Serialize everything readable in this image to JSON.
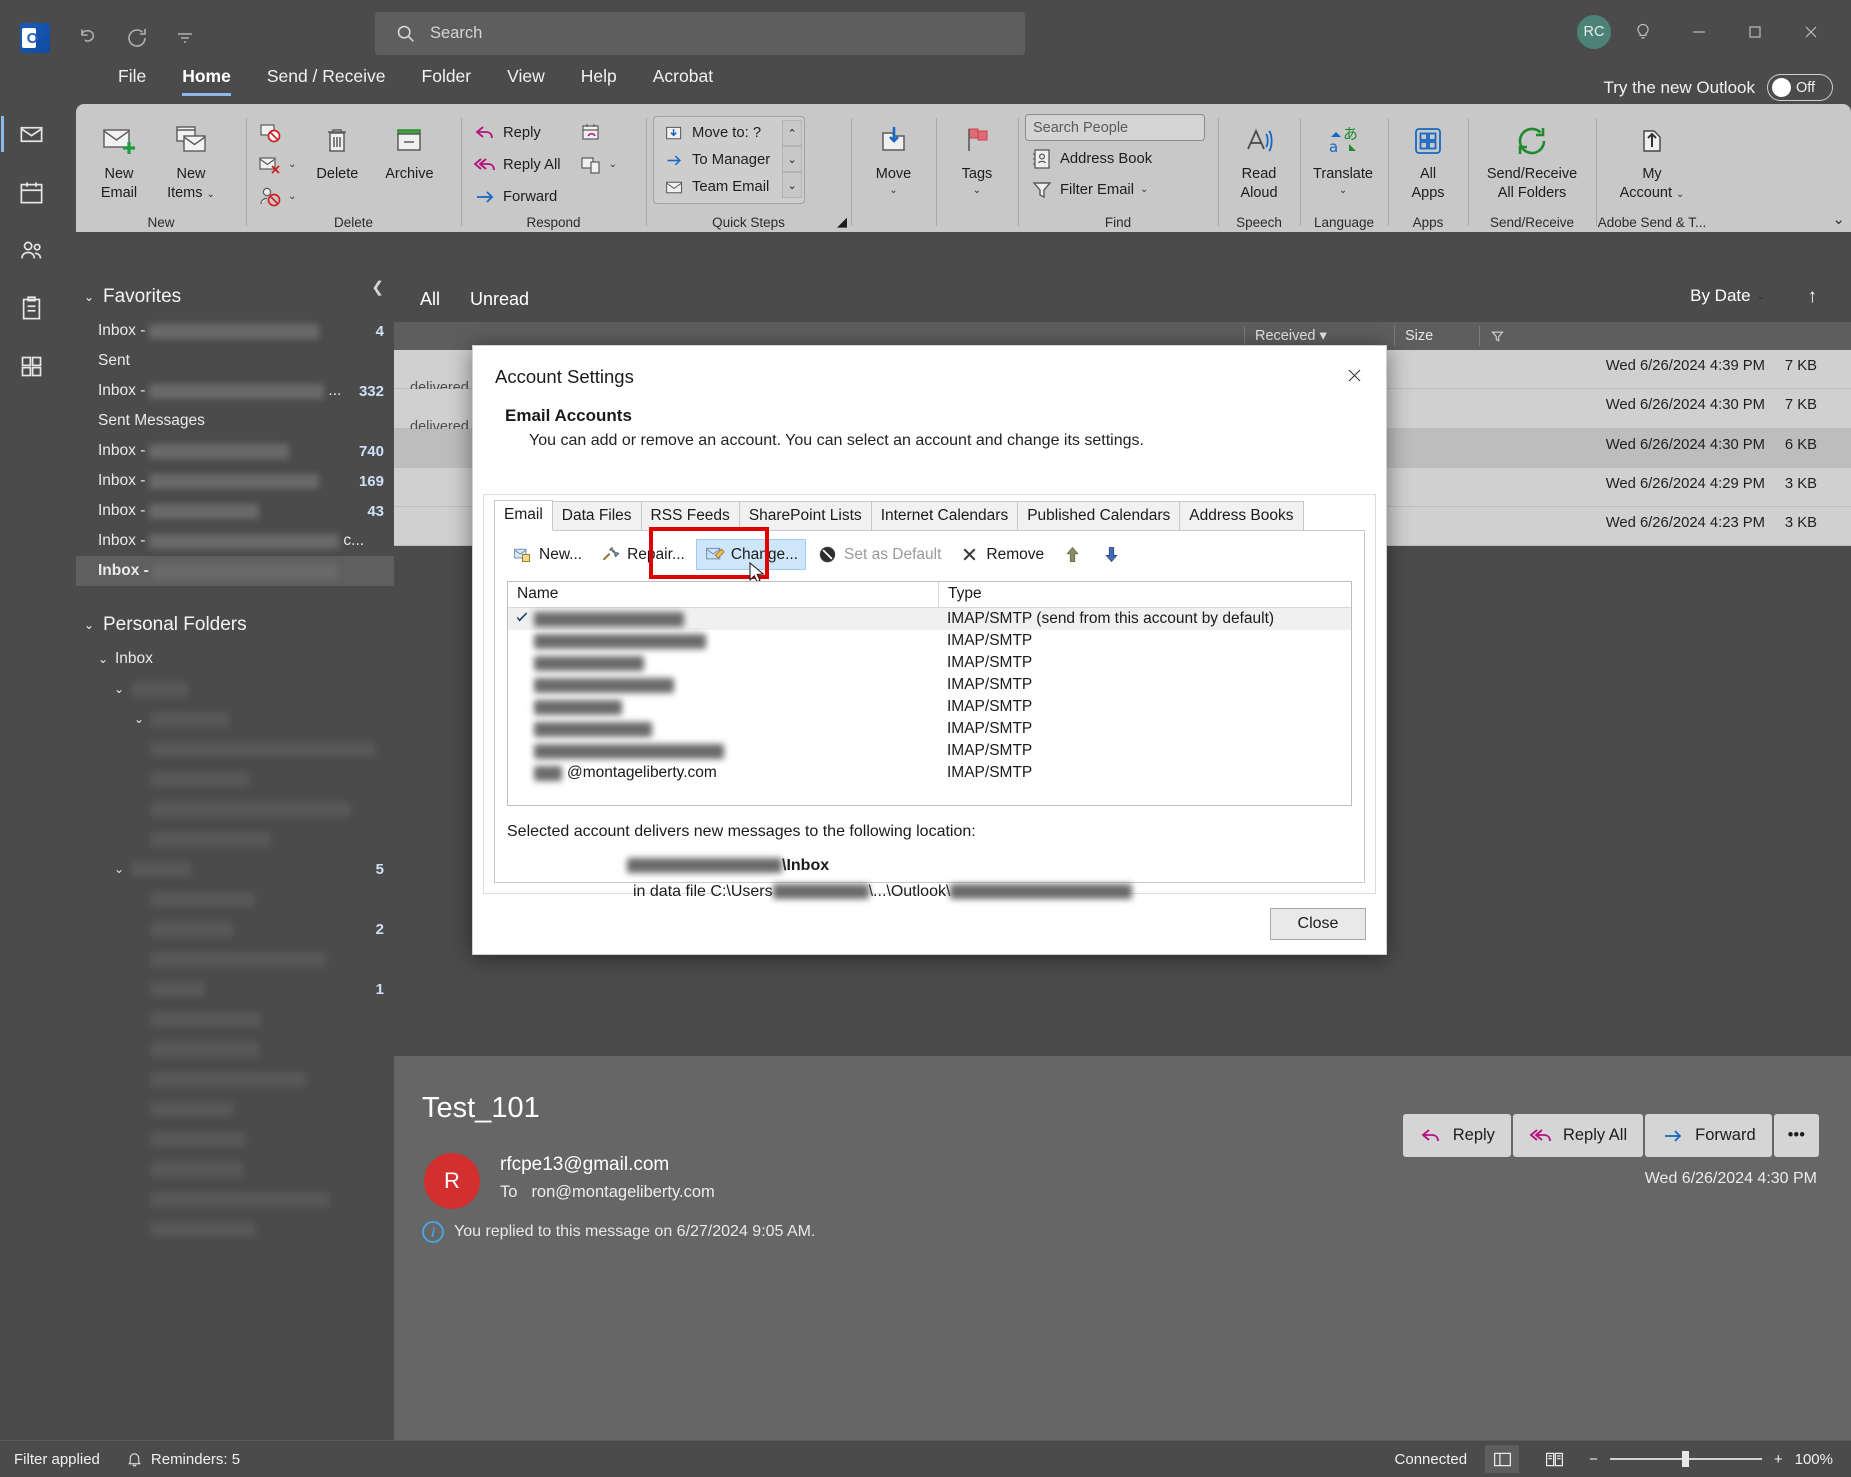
{
  "titlebar": {
    "app_icon": "outlook-logo",
    "quick_access": [
      {
        "name": "undo-icon",
        "label": "Undo"
      },
      {
        "name": "send-receive-icon",
        "label": "Send/Receive All Folders"
      },
      {
        "name": "customize-qat-icon",
        "label": "Customize Quick Access Toolbar"
      }
    ],
    "search_placeholder": "Search",
    "account_initials": "RC",
    "tip_icon": "lightbulb-icon",
    "minimize": "Minimize",
    "maximize": "Maximize",
    "close": "Close"
  },
  "menubar": {
    "items": [
      {
        "label": "File",
        "active": false
      },
      {
        "label": "Home",
        "active": true
      },
      {
        "label": "Send / Receive",
        "active": false
      },
      {
        "label": "Folder",
        "active": false
      },
      {
        "label": "View",
        "active": false
      },
      {
        "label": "Help",
        "active": false
      },
      {
        "label": "Acrobat",
        "active": false
      }
    ],
    "try_new_outlook": "Try the new Outlook",
    "toggle_state": "Off"
  },
  "rail": {
    "items": [
      {
        "name": "mail-icon",
        "label": "Mail",
        "selected": true
      },
      {
        "name": "calendar-icon",
        "label": "Calendar",
        "selected": false
      },
      {
        "name": "people-icon",
        "label": "People",
        "selected": false
      },
      {
        "name": "tasks-icon",
        "label": "To Do",
        "selected": false
      },
      {
        "name": "more-apps-icon",
        "label": "More Apps",
        "selected": false
      }
    ]
  },
  "ribbon": {
    "groups": [
      {
        "label": "New",
        "buttons": [
          {
            "label_l1": "New",
            "label_l2": "Email",
            "icon": "new-email-icon"
          },
          {
            "label_l1": "New",
            "label_l2": "Items",
            "icon": "new-items-icon",
            "dropdown": true
          }
        ]
      },
      {
        "label": "Delete",
        "small": [
          {
            "label": "",
            "icon": "ignore-icon"
          },
          {
            "label": "",
            "icon": "junk-icon",
            "dropdown": true
          },
          {
            "label": "",
            "icon": "block-sender-icon",
            "dropdown": true
          }
        ],
        "buttons": [
          {
            "label_l1": "Delete",
            "label_l2": "",
            "icon": "delete-icon"
          },
          {
            "label_l1": "Archive",
            "label_l2": "",
            "icon": "archive-icon"
          }
        ]
      },
      {
        "label": "Respond",
        "small": [
          {
            "label": "Reply",
            "icon": "reply-icon"
          },
          {
            "label": "Reply All",
            "icon": "reply-all-icon"
          },
          {
            "label": "Forward",
            "icon": "forward-icon"
          }
        ],
        "small2": [
          {
            "label": "",
            "icon": "meeting-icon"
          },
          {
            "label": "",
            "icon": "more-respond-icon",
            "dropdown": true
          }
        ]
      },
      {
        "label": "Quick Steps",
        "quick_steps": [
          {
            "label": "Move to: ?",
            "icon": "move-to-icon"
          },
          {
            "label": "To Manager",
            "icon": "to-manager-icon"
          },
          {
            "label": "Team Email",
            "icon": "team-email-icon"
          }
        ],
        "has_dialog_launcher": true
      },
      {
        "label": "",
        "buttons": [
          {
            "label_l1": "Move",
            "label_l2": "",
            "icon": "move-icon",
            "dropdown": true
          }
        ]
      },
      {
        "label": "",
        "buttons": [
          {
            "label_l1": "Tags",
            "label_l2": "",
            "icon": "tags-icon",
            "dropdown": true
          }
        ]
      },
      {
        "label": "Find",
        "search_people_placeholder": "Search People",
        "small": [
          {
            "label": "Address Book",
            "icon": "address-book-icon"
          },
          {
            "label": "Filter Email",
            "icon": "filter-email-icon",
            "dropdown": true
          }
        ]
      },
      {
        "label": "Speech",
        "buttons": [
          {
            "label_l1": "Read",
            "label_l2": "Aloud",
            "icon": "read-aloud-icon"
          }
        ]
      },
      {
        "label": "Language",
        "buttons": [
          {
            "label_l1": "Translate",
            "label_l2": "",
            "icon": "translate-icon",
            "dropdown": true
          }
        ]
      },
      {
        "label": "Apps",
        "buttons": [
          {
            "label_l1": "All",
            "label_l2": "Apps",
            "icon": "all-apps-icon"
          }
        ]
      },
      {
        "label": "Send/Receive",
        "buttons": [
          {
            "label_l1": "Send/Receive",
            "label_l2": "All Folders",
            "icon": "send-receive-all-icon"
          }
        ]
      },
      {
        "label": "Adobe Send & T...",
        "buttons": [
          {
            "label_l1": "My",
            "label_l2": "Account",
            "icon": "adobe-account-icon",
            "dropdown": true
          }
        ]
      }
    ]
  },
  "folder_pane": {
    "favorites_header": "Favorites",
    "favorites": [
      {
        "prefix": "Inbox -",
        "redacted": true,
        "redact_width": 170,
        "count": "4"
      },
      {
        "prefix": "Sent",
        "redacted": false,
        "redact_width": 0,
        "count": ""
      },
      {
        "prefix": "Inbox -",
        "redacted": true,
        "redact_width": 175,
        "suffix": "...",
        "count": "332"
      },
      {
        "prefix": "Sent Messages",
        "redacted": false,
        "redact_width": 0,
        "count": ""
      },
      {
        "prefix": "Inbox -",
        "redacted": true,
        "redact_width": 140,
        "count": "740"
      },
      {
        "prefix": "Inbox -",
        "redacted": true,
        "redact_width": 170,
        "count": "169"
      },
      {
        "prefix": "Inbox -",
        "redacted": true,
        "redact_width": 110,
        "count": "43"
      },
      {
        "prefix": "Inbox -",
        "redacted": true,
        "redact_width": 190,
        "suffix": "c...",
        "count": ""
      },
      {
        "prefix": "Inbox -",
        "redacted": true,
        "redact_width": 185,
        "count": "",
        "selected": true
      }
    ],
    "personal_header": "Personal Folders",
    "personal": [
      {
        "label": "Inbox",
        "indent": 0,
        "caret": true,
        "redacted": false,
        "redact_width": 0,
        "count": ""
      },
      {
        "label": "",
        "indent": 1,
        "caret": true,
        "redacted": true,
        "redact_width": 58,
        "count": ""
      },
      {
        "label": "",
        "indent": 2,
        "caret": true,
        "redacted": true,
        "redact_width": 78,
        "count": ""
      },
      {
        "label": "",
        "indent": 2,
        "caret": false,
        "redacted": true,
        "redact_width": 225,
        "count": ""
      },
      {
        "label": "",
        "indent": 2,
        "caret": false,
        "redacted": true,
        "redact_width": 98,
        "count": ""
      },
      {
        "label": "",
        "indent": 2,
        "caret": false,
        "redacted": true,
        "redact_width": 200,
        "count": ""
      },
      {
        "label": "",
        "indent": 2,
        "caret": false,
        "redacted": true,
        "redact_width": 120,
        "count": ""
      },
      {
        "label": "",
        "indent": 1,
        "caret": true,
        "redacted": true,
        "redact_width": 60,
        "count": "5"
      },
      {
        "label": "",
        "indent": 2,
        "caret": false,
        "redacted": true,
        "redact_width": 104,
        "count": ""
      },
      {
        "label": "",
        "indent": 2,
        "caret": false,
        "redacted": true,
        "redact_width": 82,
        "count": "2"
      },
      {
        "label": "",
        "indent": 2,
        "caret": false,
        "redacted": true,
        "redact_width": 175,
        "count": ""
      },
      {
        "label": "",
        "indent": 2,
        "caret": false,
        "redacted": true,
        "redact_width": 54,
        "count": "1"
      },
      {
        "label": "",
        "indent": 2,
        "caret": false,
        "redacted": true,
        "redact_width": 110,
        "count": ""
      },
      {
        "label": "",
        "indent": 2,
        "caret": false,
        "redacted": true,
        "redact_width": 108,
        "count": ""
      },
      {
        "label": "",
        "indent": 2,
        "caret": false,
        "redacted": true,
        "redact_width": 155,
        "count": ""
      },
      {
        "label": "",
        "indent": 2,
        "caret": false,
        "redacted": true,
        "redact_width": 82,
        "count": ""
      },
      {
        "label": "",
        "indent": 2,
        "caret": false,
        "redacted": true,
        "redact_width": 95,
        "count": ""
      },
      {
        "label": "",
        "indent": 2,
        "caret": false,
        "redacted": true,
        "redact_width": 92,
        "count": ""
      },
      {
        "label": "",
        "indent": 2,
        "caret": false,
        "redacted": true,
        "redact_width": 178,
        "count": ""
      },
      {
        "label": "",
        "indent": 2,
        "caret": false,
        "redacted": true,
        "redact_width": 105,
        "count": ""
      }
    ]
  },
  "message_list": {
    "filters": [
      {
        "label": "All",
        "active": true
      },
      {
        "label": "Unread",
        "active": false
      }
    ],
    "sort_label": "By Date",
    "columns": [
      "Received",
      "Size"
    ],
    "flag_column_icon": "flag-filter-icon",
    "rows": [
      {
        "received": "Wed 6/26/2024 4:39 PM",
        "size": "7 KB",
        "preview": "delivered to one or more recipients. It's",
        "selected": false
      },
      {
        "received": "Wed 6/26/2024 4:30 PM",
        "size": "7 KB",
        "preview": "delivered to one or more recipients. It's",
        "selected": false
      },
      {
        "received": "Wed 6/26/2024 4:30 PM",
        "size": "6 KB",
        "preview": "",
        "selected": true
      },
      {
        "received": "Wed 6/26/2024 4:29 PM",
        "size": "3 KB",
        "preview": "",
        "selected": false
      },
      {
        "received": "Wed 6/26/2024 4:23 PM",
        "size": "3 KB",
        "preview": "",
        "selected": false
      }
    ]
  },
  "reading_pane": {
    "subject": "Test_101",
    "avatar_letter": "R",
    "from": "rfcpe13@gmail.com",
    "to_label": "To",
    "to": "ron@montageliberty.com",
    "notice": "You replied to this message on 6/27/2024 9:05 AM.",
    "date": "Wed 6/26/2024 4:30 PM",
    "actions": [
      {
        "label": "Reply",
        "icon": "reply-icon"
      },
      {
        "label": "Reply All",
        "icon": "reply-all-icon"
      },
      {
        "label": "Forward",
        "icon": "forward-icon"
      },
      {
        "label": "•••",
        "icon": "more-actions-icon"
      }
    ]
  },
  "dialog": {
    "title": "Account Settings",
    "heading": "Email Accounts",
    "subheading": "You can add or remove an account. You can select an account and change its settings.",
    "tabs": [
      {
        "label": "Email",
        "active": true
      },
      {
        "label": "Data Files",
        "active": false
      },
      {
        "label": "RSS Feeds",
        "active": false
      },
      {
        "label": "SharePoint Lists",
        "active": false
      },
      {
        "label": "Internet Calendars",
        "active": false
      },
      {
        "label": "Published Calendars",
        "active": false
      },
      {
        "label": "Address Books",
        "active": false
      }
    ],
    "toolbar": [
      {
        "label": "New...",
        "icon": "new-account-icon",
        "disabled": false,
        "highlighted": false
      },
      {
        "label": "Repair...",
        "icon": "repair-icon",
        "disabled": false,
        "highlighted": false
      },
      {
        "label": "Change...",
        "icon": "change-icon",
        "disabled": false,
        "highlighted": true
      },
      {
        "label": "Set as Default",
        "icon": "set-default-icon",
        "disabled": true,
        "highlighted": false
      },
      {
        "label": "Remove",
        "icon": "remove-icon",
        "disabled": false,
        "highlighted": false
      },
      {
        "label": "",
        "icon": "move-up-icon",
        "disabled": false,
        "highlighted": false
      },
      {
        "label": "",
        "icon": "move-down-icon",
        "disabled": false,
        "highlighted": false
      }
    ],
    "grid_columns": [
      "Name",
      "Type"
    ],
    "accounts": [
      {
        "name": "",
        "redacted": true,
        "redact_width": 150,
        "type": "IMAP/SMTP (send from this account by default)",
        "default": true,
        "selected": true
      },
      {
        "name": "",
        "redacted": true,
        "redact_width": 172,
        "type": "IMAP/SMTP",
        "default": false,
        "selected": false
      },
      {
        "name": "",
        "redacted": true,
        "redact_width": 110,
        "type": "IMAP/SMTP",
        "default": false,
        "selected": false
      },
      {
        "name": "",
        "redacted": true,
        "redact_width": 140,
        "type": "IMAP/SMTP",
        "default": false,
        "selected": false
      },
      {
        "name": "",
        "redacted": true,
        "redact_width": 88,
        "type": "IMAP/SMTP",
        "default": false,
        "selected": false
      },
      {
        "name": "",
        "redacted": true,
        "redact_width": 118,
        "type": "IMAP/SMTP",
        "default": false,
        "selected": false
      },
      {
        "name": "",
        "redacted": true,
        "redact_width": 190,
        "type": "IMAP/SMTP",
        "default": false,
        "selected": false
      },
      {
        "name": "@montageliberty.com",
        "redacted": true,
        "redact_width": 28,
        "type": "IMAP/SMTP",
        "default": false,
        "selected": false
      }
    ],
    "delivery_label": "Selected account delivers new messages to the following location:",
    "delivery_location_suffix": "\\Inbox",
    "delivery_datafile_prefix": "in data file C:\\Users",
    "delivery_datafile_mid": "\\...\\Outlook\\",
    "close_label": "Close"
  },
  "statusbar": {
    "filter_text": "Filter applied",
    "reminders": "Reminders: 5",
    "connection": "Connected",
    "view_normal_icon": "normal-view-icon",
    "view_reading_icon": "reading-view-icon",
    "zoom_out": "−",
    "zoom_in": "+",
    "zoom_level": "100%"
  }
}
